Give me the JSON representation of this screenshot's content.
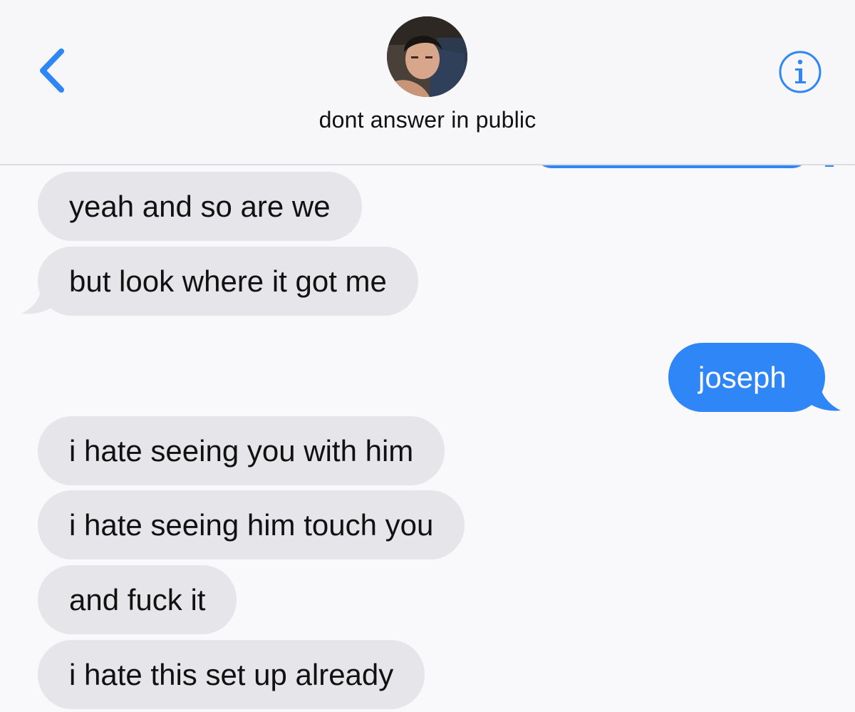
{
  "header": {
    "contact_name": "dont answer in public",
    "back_icon": "chevron-left-icon",
    "info_icon": "info-icon",
    "accent_color": "#2f86f6"
  },
  "messages": [
    {
      "direction": "incoming",
      "text": "yeah and so are we"
    },
    {
      "direction": "incoming",
      "text": "but look where it got me"
    },
    {
      "direction": "outgoing",
      "text": "joseph"
    },
    {
      "direction": "incoming",
      "text": "i hate seeing you with him"
    },
    {
      "direction": "incoming",
      "text": "i hate seeing him touch you"
    },
    {
      "direction": "incoming",
      "text": "and fuck it"
    },
    {
      "direction": "incoming",
      "text": "i hate this set up already"
    }
  ],
  "colors": {
    "incoming_bubble": "#e5e5ea",
    "outgoing_bubble": "#2f86f6",
    "background": "#f9f9fb"
  }
}
